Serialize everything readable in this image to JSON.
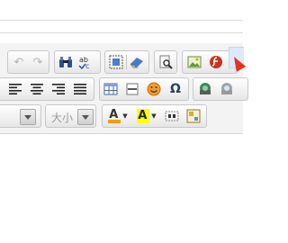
{
  "toolbar": {
    "row1": {
      "undo_icon": "undo-icon",
      "redo_icon": "redo-icon",
      "find_icon": "binoculars-icon",
      "spellcheck_icon": "spellcheck-icon",
      "select_all_icon": "select-all-icon",
      "eraser_icon": "eraser-icon",
      "preview_icon": "preview-icon",
      "image_icon": "image-icon",
      "flash_icon": "flash-icon"
    },
    "row2": {
      "align_left_icon": "align-left-icon",
      "align_center_icon": "align-center-icon",
      "align_right_icon": "align-right-icon",
      "justify_icon": "justify-icon",
      "table_icon": "table-icon",
      "horizontal_rule_icon": "horizontal-rule-icon",
      "smiley_icon": "smiley-icon",
      "special_char_icon": "omega-icon",
      "omega_glyph": "Ω",
      "anchor_icon": "anchor-icon",
      "unlink_icon": "unlink-icon"
    },
    "row3": {
      "font_size_label": "大小",
      "text_color_glyph": "A",
      "bg_color_glyph": "A",
      "text_color_accent": "#f0a000",
      "bg_color_accent": "#ffff00",
      "show_blocks_icon": "show-blocks-icon",
      "maximize_icon": "maximize-icon"
    }
  },
  "colors": {
    "toolbar_bg": "#f3f3f3",
    "highlight": "#dbe9ff",
    "pointer": "#e3341b"
  }
}
